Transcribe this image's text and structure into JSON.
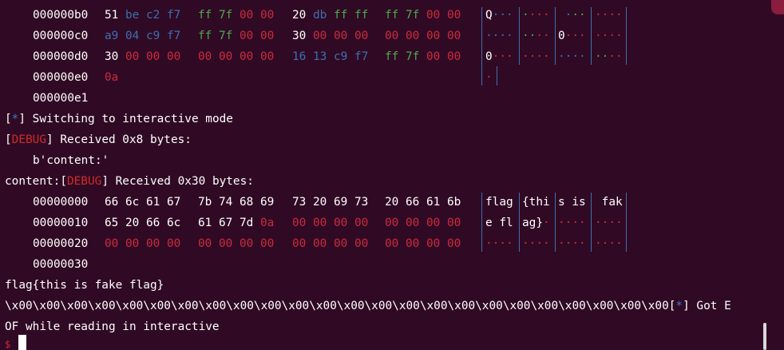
{
  "hexdump1": {
    "rows": [
      {
        "addr": "000000b0",
        "bytes": [
          "51 be c2 f7",
          "ff 7f 00 00",
          "20 db ff ff",
          "ff 7f 00 00"
        ],
        "ascii": [
          "Q···",
          "····",
          " ···",
          "····"
        ]
      },
      {
        "addr": "000000c0",
        "bytes": [
          "a9 04 c9 f7",
          "ff 7f 00 00",
          "30 00 00 00",
          "00 00 00 00"
        ],
        "ascii": [
          "····",
          "····",
          "0···",
          "····"
        ]
      },
      {
        "addr": "000000d0",
        "bytes": [
          "30 00 00 00",
          "00 00 00 00",
          "16 13 c9 f7",
          "ff 7f 00 00"
        ],
        "ascii": [
          "0···",
          "····",
          "····",
          "····"
        ]
      },
      {
        "addr": "000000e0",
        "bytes": [
          "0a"
        ],
        "ascii": [
          "·"
        ]
      },
      {
        "addr": "000000e1"
      }
    ]
  },
  "log": {
    "switch_star": "*",
    "switch_text": " Switching to interactive mode",
    "debug_tag": "DEBUG",
    "recv1_text": " Received 0x8 bytes:",
    "recv1_payload": "b'content:'",
    "content_prefix": "content:",
    "recv2_text": " Received 0x30 bytes:"
  },
  "hexdump2": {
    "rows": [
      {
        "addr": "00000000",
        "bytes": [
          "66 6c 61 67",
          "7b 74 68 69",
          "73 20 69 73",
          "20 66 61 6b"
        ],
        "ascii": [
          "flag",
          "{thi",
          "s is",
          " fak"
        ]
      },
      {
        "addr": "00000010",
        "bytes": [
          "65 20 66 6c",
          "61 67 7d 0a",
          "00 00 00 00",
          "00 00 00 00"
        ],
        "ascii": [
          "e fl",
          "ag}·",
          "····",
          "····"
        ]
      },
      {
        "addr": "00000020",
        "bytes": [
          "00 00 00 00",
          "00 00 00 00",
          "00 00 00 00",
          "00 00 00 00"
        ],
        "ascii": [
          "····",
          "····",
          "····",
          "····"
        ]
      },
      {
        "addr": "00000030"
      }
    ]
  },
  "output": {
    "flag": "flag{this is fake flag}",
    "nulls": "\\x00\\x00\\x00\\x00\\x00\\x00\\x00\\x00\\x00\\x00\\x00\\x00\\x00\\x00\\x00\\x00\\x00\\x00\\x00\\x00\\x00\\x00\\x00\\x00",
    "eof_star": "*",
    "eof_line1": " Got E",
    "eof_line2": "OF while reading in interactive",
    "prompt": "$"
  },
  "colors": {
    "background": "#300a24",
    "text": "#ffffff",
    "null_byte": "#cc2b3c",
    "ff_byte": "#4ea84e",
    "other_byte": "#3d6fb0",
    "debug": "#d02a2a",
    "star": "#3b7bd0"
  }
}
